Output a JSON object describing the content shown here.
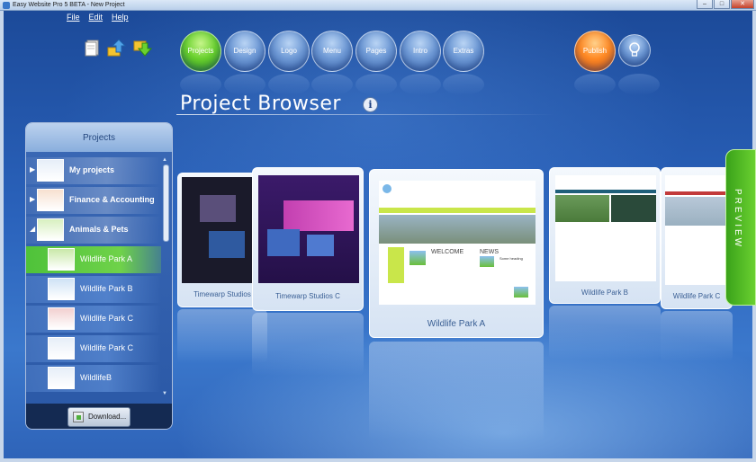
{
  "window": {
    "title": "Easy Website Pro 5 BETA - New Project",
    "minimize": "–",
    "maximize": "□",
    "close": "✕"
  },
  "menu": {
    "file": "File",
    "edit": "Edit",
    "help": "Help"
  },
  "toolbar": {
    "new_icon": "new-document-icon",
    "upload_icon": "upload-arrow-icon",
    "download_icon": "download-arrow-icon"
  },
  "nav": {
    "projects": "Projects",
    "design": "Design",
    "logo": "Logo",
    "menu": "Menu",
    "pages": "Pages",
    "intro": "Intro",
    "extras": "Extras",
    "publish": "Publish",
    "bulb_icon": "lightbulb-icon"
  },
  "heading": "Project Browser",
  "info_symbol": "i",
  "panel": {
    "title": "Projects",
    "items": [
      {
        "label": "My projects",
        "kind": "category",
        "arrow": "▶"
      },
      {
        "label": "Finance & Accounting",
        "kind": "category",
        "arrow": "▶"
      },
      {
        "label": "Animals & Pets",
        "kind": "category",
        "arrow": "◢"
      },
      {
        "label": "Wildlife Park A",
        "kind": "selected"
      },
      {
        "label": "Wildlife Park B",
        "kind": "child"
      },
      {
        "label": "Wildlife Park C",
        "kind": "child"
      },
      {
        "label": "Wildlife Park C",
        "kind": "child"
      },
      {
        "label": "WildlifeB",
        "kind": "child"
      }
    ],
    "download_label": "Download...",
    "scroll_up": "▲",
    "scroll_down": "▼"
  },
  "cards": {
    "far_left": "Timewarp Studios",
    "left": "Timewarp Studios C",
    "center": "Wildlife Park A",
    "right": "Wildlife Park B",
    "far_right": "Wildlife Park C",
    "center_site": {
      "welcome": "WELCOME",
      "news": "NEWS",
      "news_heading": "Some heading"
    }
  },
  "preview_label": "PREVIEW",
  "colors": {
    "accent_green": "#5cc232",
    "publish_orange": "#ff8a25",
    "background_blue": "#2a62bb"
  }
}
